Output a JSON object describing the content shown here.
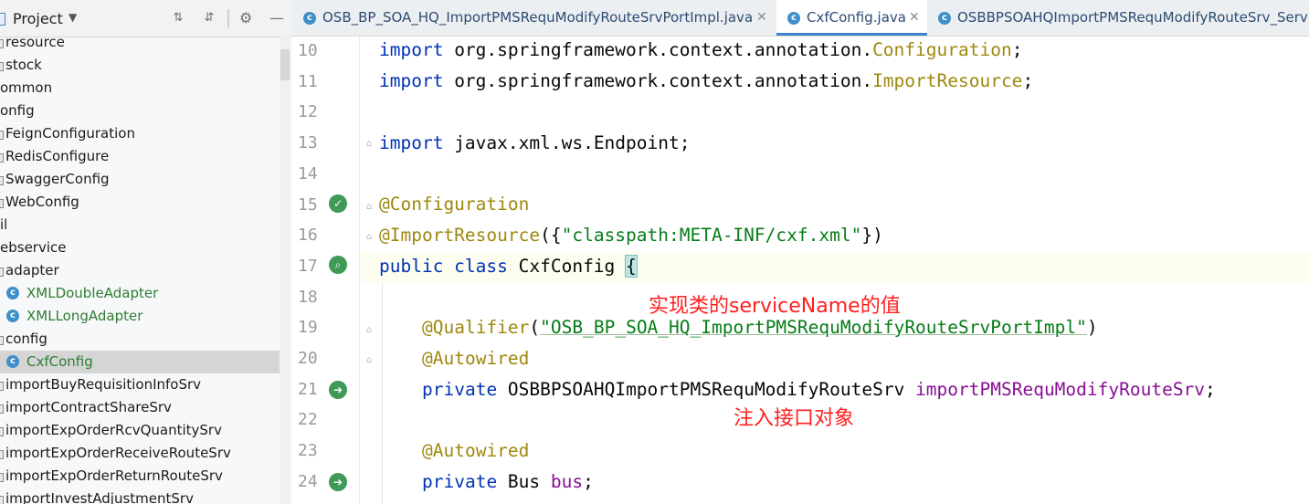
{
  "project_panel": {
    "title": "Project",
    "tree": [
      {
        "label": "resource",
        "kind": "folder"
      },
      {
        "label": "stock",
        "kind": "folder"
      },
      {
        "label": "ommon",
        "kind": "folder"
      },
      {
        "label": "onfig",
        "kind": "folder"
      },
      {
        "label": "FeignConfiguration",
        "kind": "file"
      },
      {
        "label": "RedisConfigure",
        "kind": "file"
      },
      {
        "label": "SwaggerConfig",
        "kind": "file"
      },
      {
        "label": "WebConfig",
        "kind": "file"
      },
      {
        "label": "il",
        "kind": "folder"
      },
      {
        "label": "ebservice",
        "kind": "folder"
      },
      {
        "label": "adapter",
        "kind": "folder"
      },
      {
        "label": "XMLDoubleAdapter",
        "kind": "class"
      },
      {
        "label": "XMLLongAdapter",
        "kind": "class"
      },
      {
        "label": "config",
        "kind": "folder"
      },
      {
        "label": "CxfConfig",
        "kind": "class",
        "selected": true
      },
      {
        "label": "importBuyRequisitionInfoSrv",
        "kind": "folder"
      },
      {
        "label": "importContractShareSrv",
        "kind": "folder"
      },
      {
        "label": "importExpOrderRcvQuantitySrv",
        "kind": "folder"
      },
      {
        "label": "importExpOrderReceiveRouteSrv",
        "kind": "folder"
      },
      {
        "label": "importExpOrderReturnRouteSrv",
        "kind": "folder"
      },
      {
        "label": "importInvestAdjustmentSrv",
        "kind": "folder"
      }
    ]
  },
  "tabs": [
    {
      "label": "OSB_BP_SOA_HQ_ImportPMSRequModifyRouteSrvPortImpl.java",
      "active": false
    },
    {
      "label": "CxfConfig.java",
      "active": true
    },
    {
      "label": "OSBBPSOAHQImportPMSRequModifyRouteSrv_Serv",
      "active": false
    }
  ],
  "editor": {
    "line_numbers": [
      "10",
      "11",
      "12",
      "13",
      "14",
      "15",
      "16",
      "17",
      "18",
      "19",
      "20",
      "21",
      "22",
      "23",
      "24"
    ],
    "code": {
      "l10_kw": "import",
      "l10_pkg": " org.springframework.context.annotation.",
      "l10_cls": "Configuration",
      "l10_end": ";",
      "l11_kw": "import",
      "l11_pkg": " org.springframework.context.annotation.",
      "l11_cls": "ImportResource",
      "l11_end": ";",
      "l13_kw": "import",
      "l13_rest": " javax.xml.ws.Endpoint;",
      "l15_an": "@Configuration",
      "l16_an": "@ImportResource",
      "l16_open": "({",
      "l16_str": "\"classpath:META-INF/cxf.xml\"",
      "l16_close": "})",
      "l17_kw": "public class",
      "l17_name": " CxfConfig ",
      "l17_brace": "{",
      "l19_an": "@Qualifier",
      "l19_open": "(",
      "l19_str": "\"OSB_BP_SOA_HQ_ImportPMSRequModifyRouteSrvPortImpl\"",
      "l19_close": ")",
      "l20_an": "@Autowired",
      "l21_kw": "private",
      "l21_type": " OSBBPSOAHQImportPMSRequModifyRouteSrv ",
      "l21_field": "importPMSRequModifyRouteSrv",
      "l21_end": ";",
      "l23_an": "@Autowired",
      "l24_kw": "private",
      "l24_type": " Bus ",
      "l24_field": "bus",
      "l24_end": ";"
    },
    "annotations": {
      "service_name_note": "实现类的serviceName的值",
      "inject_note": "注入接口对象"
    }
  },
  "colors": {
    "keyword": "#0033b3",
    "annotation": "#9e880d",
    "string": "#067d17",
    "field": "#871094",
    "note": "#ff1f1f",
    "class_green": "#2e7d32"
  }
}
